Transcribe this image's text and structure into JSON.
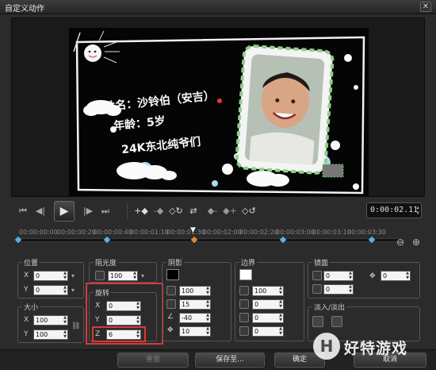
{
  "window": {
    "title": "自定义动作",
    "close_glyph": "✕"
  },
  "preview": {
    "text_line1": "姓名：沙铃伯（安吉）",
    "text_line2": "年龄：5岁",
    "text_line3": "24K东北纯爷们"
  },
  "transport": {
    "buttons": [
      "⏮",
      "◀|",
      "▶",
      "|▶",
      "⏭"
    ],
    "play_glyph": "▶",
    "tools": [
      "+◆",
      "-◆",
      "◇↻",
      "⇄",
      "◆-",
      "◆+",
      "◇↺"
    ],
    "timecode": "0:00:02.11"
  },
  "timeline": {
    "ruler": [
      "00:00:00:00",
      "00:00:00:20",
      "00:00:00:40",
      "00:00:01:10",
      "00:00:01:30",
      "00:00:02:00",
      "00:00:02:20",
      "00:00:03:00",
      "00:00:03:10",
      "00:00:03:30",
      "00:00:04:00"
    ],
    "playhead_glyph": "▼",
    "zoom_out": "⊖",
    "zoom_in": "⊕"
  },
  "position": {
    "label": "位置",
    "x_label": "X",
    "x_value": "0",
    "y_label": "Y",
    "y_value": "0"
  },
  "size": {
    "label": "大小",
    "x_label": "X",
    "x_value": "100",
    "y_label": "Y",
    "y_value": "100"
  },
  "opacity": {
    "label": "阻光度",
    "value": "100"
  },
  "rotation": {
    "label": "旋转",
    "x_label": "X",
    "x_value": "0",
    "y_label": "Y",
    "y_value": "0",
    "z_label": "Z",
    "z_value": "6"
  },
  "shadow": {
    "label": "阴影",
    "color": "#000000",
    "opacity_value": "100",
    "blur_value": "15",
    "angle_value": "-40",
    "distance_value": "10"
  },
  "border": {
    "label": "边界",
    "color": "#ffffff",
    "opacity_value": "100",
    "width_value": "0",
    "blur_value": "0",
    "extra_value": "0"
  },
  "mirror": {
    "label": "镜面",
    "value1": "0",
    "value2": "0",
    "value3": "0"
  },
  "fade": {
    "label": "淡入/淡出"
  },
  "bottom": {
    "reset_label": "重置",
    "save_as_label": "保存至...",
    "ok_label": "确定",
    "cancel_label": "取消"
  },
  "watermark": {
    "text": "好特游戏"
  },
  "colors": {
    "highlight": "#d93a36",
    "keyframe": "#4fb6e8",
    "keyframe_active": "#e2892b"
  }
}
